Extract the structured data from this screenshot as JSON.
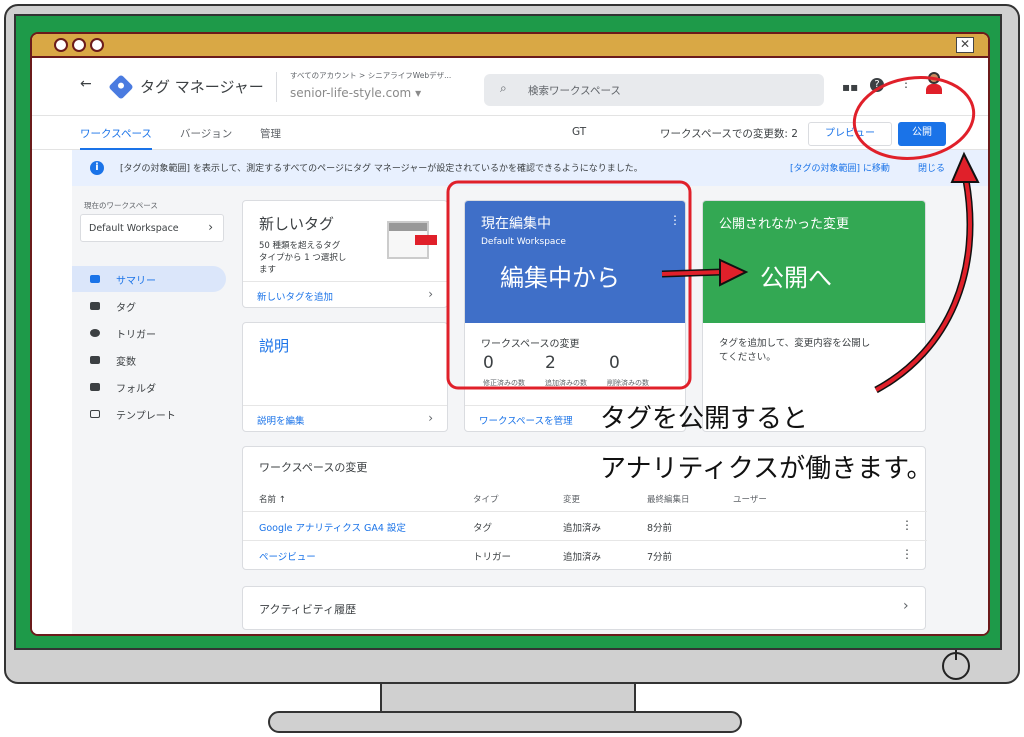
{
  "app": {
    "title": "タグ マネージャー",
    "account_path": "すべてのアカウント > シニアライフWebデザ...",
    "container": "senior-life-style.com",
    "search_placeholder": "検索ワークスペース"
  },
  "tabs": [
    {
      "label": "ワークスペース"
    },
    {
      "label": "バージョン"
    },
    {
      "label": "管理"
    }
  ],
  "toolbar": {
    "gt_id": "GT",
    "changes_text": "ワークスペースでの変更数: 2",
    "preview_label": "プレビュー",
    "publish_label": "公開"
  },
  "banner": {
    "text": "[タグの対象範囲] を表示して、測定するすべてのページにタグ マネージャーが設定されているかを確認できるようになりました。",
    "link": "[タグの対象範囲] に移動",
    "dismiss": "閉じる"
  },
  "sidebar": {
    "workspace_label": "現在のワークスペース",
    "workspace_name": "Default Workspace",
    "items": [
      {
        "label": "サマリー"
      },
      {
        "label": "タグ"
      },
      {
        "label": "トリガー"
      },
      {
        "label": "変数"
      },
      {
        "label": "フォルダ"
      },
      {
        "label": "テンプレート"
      }
    ]
  },
  "cards": {
    "new_tag": {
      "title": "新しいタグ",
      "desc1": "50 種類を超えるタグ",
      "desc2": "タイプから 1 つ選択し",
      "desc3": "ます",
      "link": "新しいタグを追加"
    },
    "editing": {
      "title": "現在編集中",
      "workspace": "Default Workspace",
      "changes_title": "ワークスペースの変更",
      "counts": [
        "0",
        "2",
        "0"
      ],
      "count_labels": [
        "修正済みの数",
        "追加済みの数",
        "削除済みの数"
      ],
      "link": "ワークスペースを管理"
    },
    "unpublished": {
      "title": "公開されなかった変更",
      "desc1": "タグを追加して、変更内容を公開し",
      "desc2": "てください。"
    },
    "description": {
      "title": "説明",
      "link": "説明を編集"
    }
  },
  "changes_table": {
    "title": "ワークスペースの変更",
    "headers": [
      "名前 ↑",
      "タイプ",
      "変更",
      "最終編集日",
      "ユーザー"
    ],
    "rows": [
      [
        "Google アナリティクス GA4 設定",
        "タグ",
        "追加済み",
        "8分前"
      ],
      [
        "ページビュー",
        "トリガー",
        "追加済み",
        "7分前"
      ]
    ]
  },
  "activity": {
    "title": "アクティビティ履歴"
  },
  "annotations": {
    "from_editing": "編集中から",
    "to_publish": "公開へ",
    "caption1": "タグを公開すると",
    "caption2": "アナリティクスが働きます。"
  },
  "colors": {
    "screen_green": "#1e9a49",
    "titlebar": "#d9a845",
    "editing_blue": "#3f6fc8",
    "publish_green": "#33a853",
    "annotation_red": "#e0202a",
    "gtm_blue": "#1a73e8"
  }
}
